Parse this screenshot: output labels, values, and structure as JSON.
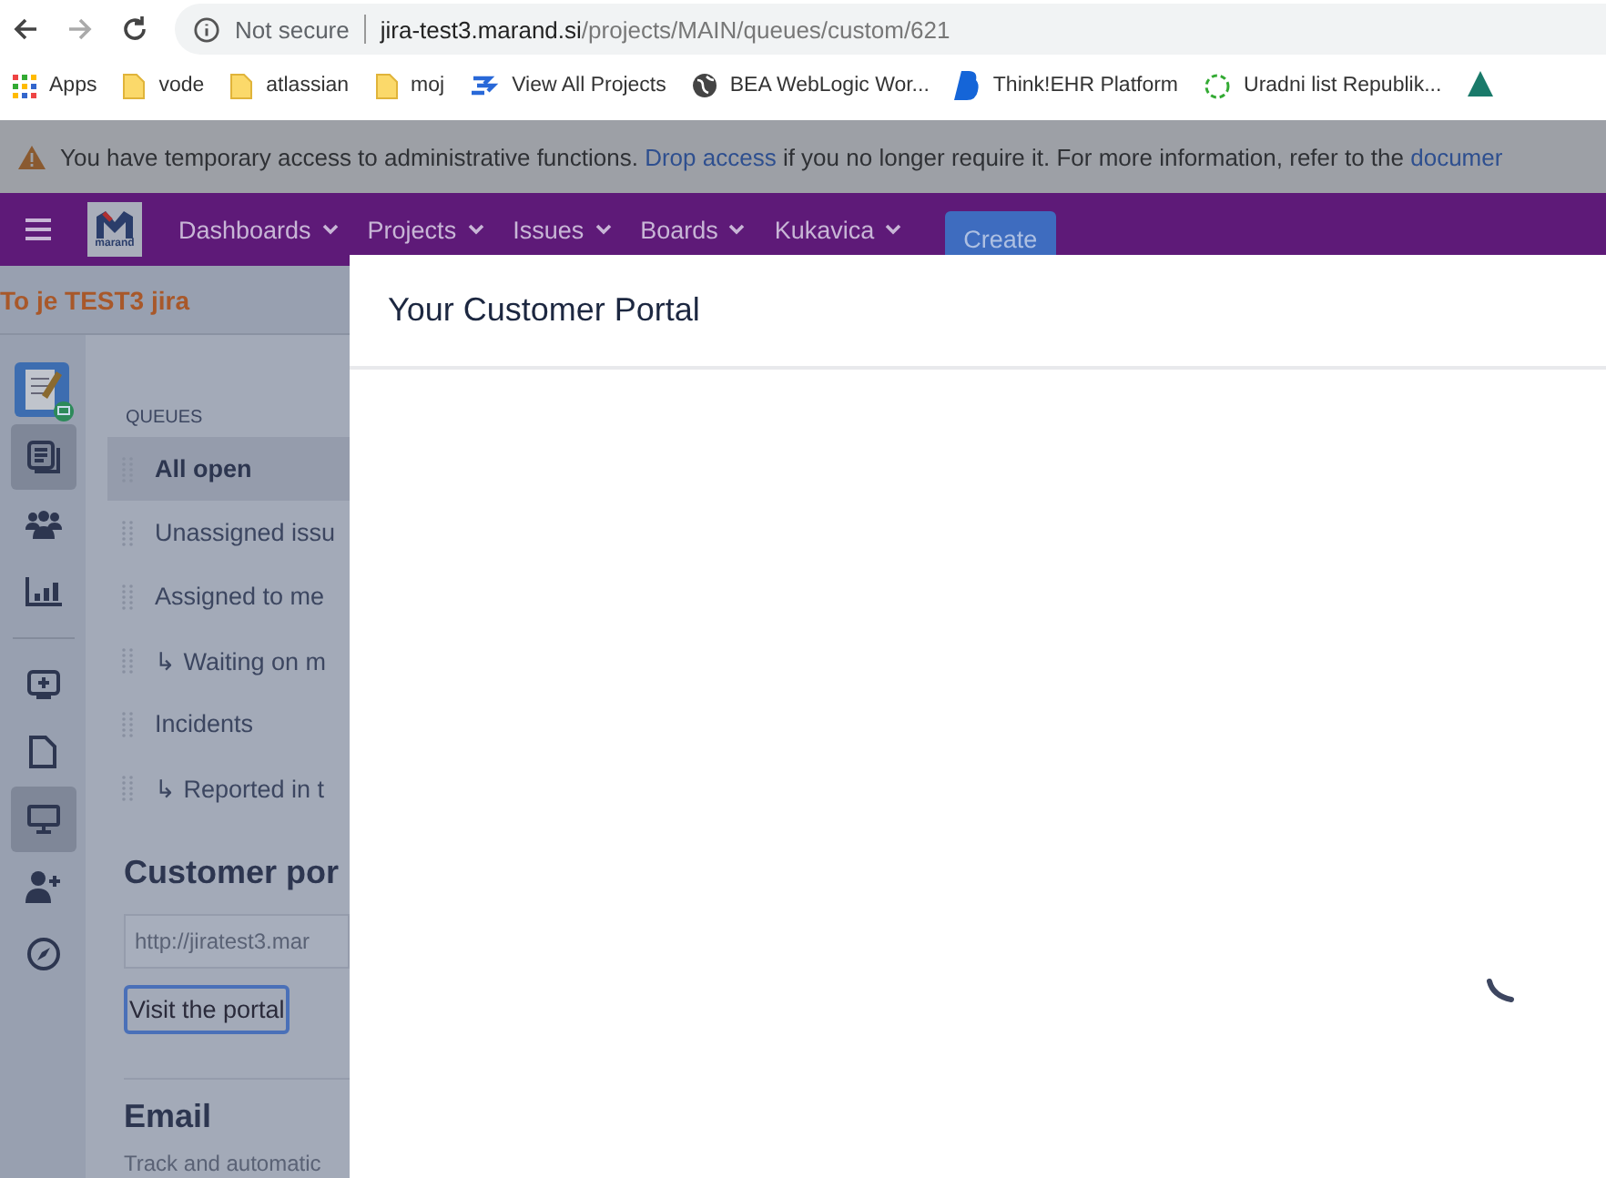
{
  "browser": {
    "security": "Not secure",
    "url_host": "jira-test3.marand.si",
    "url_path": "/projects/MAIN/queues/custom/621"
  },
  "bookmarks": [
    {
      "kind": "apps",
      "label": "Apps"
    },
    {
      "kind": "folder",
      "label": "vode"
    },
    {
      "kind": "folder",
      "label": "atlassian"
    },
    {
      "kind": "folder",
      "label": "moj"
    },
    {
      "kind": "jira",
      "label": "View All Projects"
    },
    {
      "kind": "globe",
      "label": "BEA WebLogic Wor..."
    },
    {
      "kind": "think",
      "label": "Think!EHR Platform"
    },
    {
      "kind": "ul",
      "label": "Uradni list Republik..."
    },
    {
      "kind": "tree"
    }
  ],
  "banner": {
    "before": "You have temporary access to administrative functions.",
    "link": "Drop access",
    "after": "if you no longer require it. For more information, refer to the",
    "link2": "documer"
  },
  "nav": {
    "logo": "marand",
    "items": [
      "Dashboards",
      "Projects",
      "Issues",
      "Boards",
      "Kukavica"
    ],
    "create": "Create"
  },
  "project_title": "To je TEST3 jira",
  "side_icons_top": [
    {
      "kind": "queues",
      "selected": true
    },
    {
      "kind": "people",
      "selected": false
    },
    {
      "kind": "reports",
      "selected": false
    }
  ],
  "side_icons_bottom": [
    {
      "kind": "add",
      "selected": false
    },
    {
      "kind": "page",
      "selected": false
    },
    {
      "kind": "monitor",
      "selected": true
    },
    {
      "kind": "invite",
      "selected": false
    },
    {
      "kind": "compass",
      "selected": false
    }
  ],
  "queues": {
    "heading": "QUEUES",
    "items": [
      {
        "label": "All open",
        "selected": true
      },
      {
        "label": "Unassigned issu",
        "selected": false
      },
      {
        "label": "Assigned to me",
        "selected": false
      },
      {
        "label": "↳ Waiting on m",
        "selected": false
      },
      {
        "label": "Incidents",
        "selected": false
      },
      {
        "label": "↳ Reported in t",
        "selected": false
      }
    ]
  },
  "portal_popup": {
    "title": "Customer por",
    "url": "http://jiratest3.mar",
    "button": "Visit the portal",
    "email_title": "Email",
    "email_text": "Track and automatic"
  },
  "modal": {
    "title": "Your Customer Portal",
    "loading": true
  }
}
